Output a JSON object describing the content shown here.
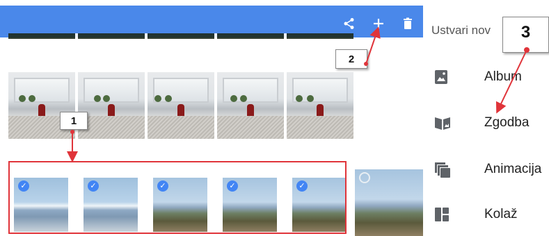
{
  "toolbar": {
    "icons": [
      "share-icon",
      "add-icon",
      "delete-icon"
    ],
    "color": "#4a88ea"
  },
  "menu": {
    "title": "Ustvari nov",
    "items": [
      {
        "label": "Album",
        "icon": "album-icon"
      },
      {
        "label": "Zgodba",
        "icon": "story-icon"
      },
      {
        "label": "Animacija",
        "icon": "animation-icon"
      },
      {
        "label": "Kolaž",
        "icon": "collage-icon"
      }
    ]
  },
  "callouts": {
    "one": "1",
    "two": "2",
    "three": "3"
  },
  "colors": {
    "selection": "#4285f4",
    "annotation": "#e0343a"
  }
}
